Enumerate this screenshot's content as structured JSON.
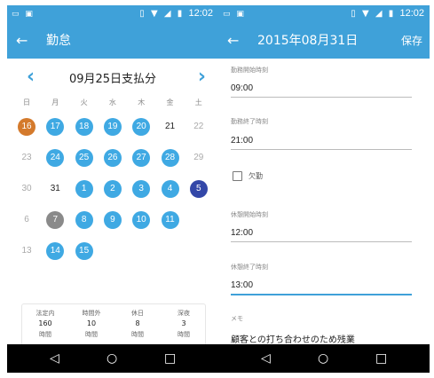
{
  "status_bar": {
    "time": "12:02"
  },
  "left": {
    "title": "勤怠",
    "month_title": "09月25日支払分",
    "weekdays": [
      "日",
      "月",
      "火",
      "水",
      "木",
      "金",
      "土"
    ],
    "days": [
      [
        "16",
        "17",
        "18",
        "19",
        "20",
        "21",
        "22"
      ],
      [
        "23",
        "24",
        "25",
        "26",
        "27",
        "28",
        "29"
      ],
      [
        "30",
        "31",
        "1",
        "2",
        "3",
        "4",
        "5"
      ],
      [
        "6",
        "7",
        "8",
        "9",
        "10",
        "11",
        ""
      ],
      [
        "13",
        "14",
        "15",
        "",
        "",
        "",
        ""
      ]
    ],
    "summary": [
      {
        "label": "法定内",
        "value": "160",
        "unit": "時間"
      },
      {
        "label": "時間外",
        "value": "10",
        "unit": "時間"
      },
      {
        "label": "休日",
        "value": "8",
        "unit": "時間"
      },
      {
        "label": "深夜",
        "value": "3",
        "unit": "時間"
      }
    ]
  },
  "right": {
    "title": "2015年08月31日",
    "save_label": "保存",
    "start_label": "勤務開始時刻",
    "start_value": "09:00",
    "end_label": "勤務終了時刻",
    "end_value": "21:00",
    "absence_label": "欠勤",
    "absence_checked": false,
    "break_start_label": "休憩開始時刻",
    "break_start_value": "12:00",
    "break_end_label": "休憩終了時刻",
    "break_end_value": "13:00",
    "memo_label": "メモ",
    "memo_value": "顧客との打ち合わせのため残業"
  },
  "colors": {
    "primary": "#3fa1d9",
    "day_blue": "#3fa9e3",
    "day_orange": "#d47a2c",
    "day_gray": "#8a8a8a",
    "day_navy": "#3347a8"
  }
}
